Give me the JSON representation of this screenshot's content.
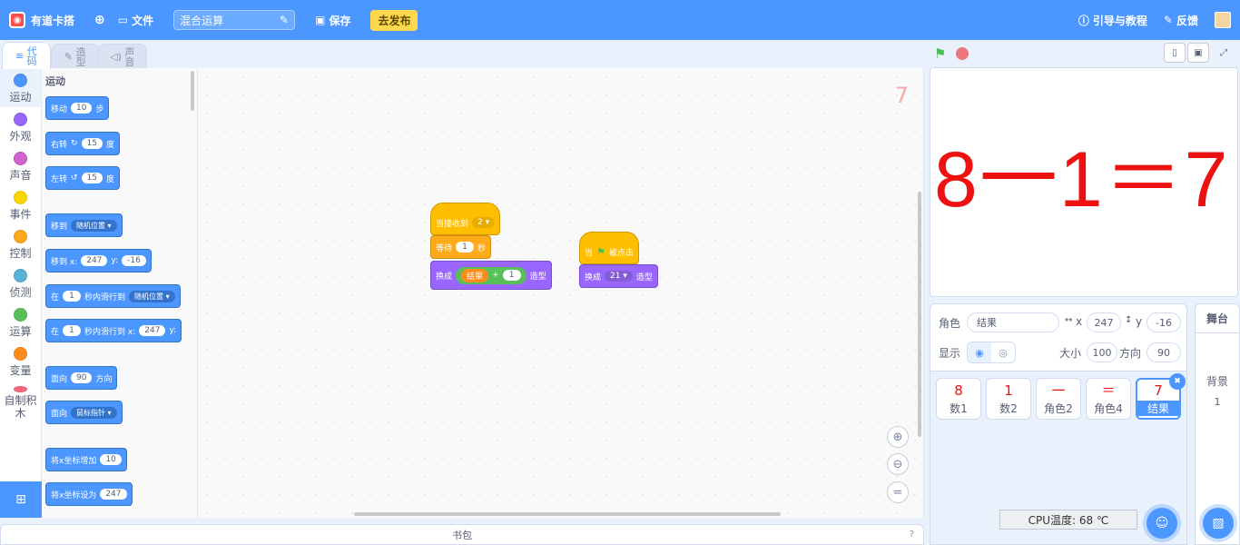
{
  "topbar": {
    "brand": "有道卡搭",
    "file_menu": "文件",
    "project_title": "混合运算",
    "save": "保存",
    "publish": "去发布",
    "guide": "引导与教程",
    "feedback": "反馈"
  },
  "tabs": {
    "code": "代码",
    "costumes": "造型",
    "sounds": "声音"
  },
  "categories": [
    {
      "label": "运动",
      "color": "#4c97ff"
    },
    {
      "label": "外观",
      "color": "#9966ff"
    },
    {
      "label": "声音",
      "color": "#cf63cf"
    },
    {
      "label": "事件",
      "color": "#ffd500"
    },
    {
      "label": "控制",
      "color": "#ffab19"
    },
    {
      "label": "侦测",
      "color": "#5cb1d6"
    },
    {
      "label": "运算",
      "color": "#59c059"
    },
    {
      "label": "变量",
      "color": "#ff8c1a"
    },
    {
      "label": "自制积木",
      "color": "#ff6680"
    }
  ],
  "palette": {
    "section": "运动",
    "move": {
      "a": "移动",
      "n": "10",
      "b": "步"
    },
    "turn_right": {
      "a": "右转",
      "icon": "rotate-cw-icon",
      "n": "15",
      "b": "度"
    },
    "turn_left": {
      "a": "左转",
      "icon": "rotate-ccw-icon",
      "n": "15",
      "b": "度"
    },
    "goto": {
      "a": "移到",
      "dd": "随机位置"
    },
    "goto_xy": {
      "a": "移到 x:",
      "x": "247",
      "b": "y:",
      "y": "-16"
    },
    "glide": {
      "a": "在",
      "n": "1",
      "b": "秒内滑行到",
      "dd": "随机位置"
    },
    "glide_xy": {
      "a": "在",
      "n": "1",
      "b": "秒内滑行到 x:",
      "x": "247",
      "c": "y:"
    },
    "point_dir": {
      "a": "面向",
      "n": "90",
      "b": "方向"
    },
    "point_towards": {
      "a": "面向",
      "dd": "鼠标指针"
    },
    "change_x": {
      "a": "将x坐标增加",
      "n": "10"
    },
    "set_x": {
      "a": "将x坐标设为",
      "n": "247"
    }
  },
  "scripts": {
    "corner_number": "7",
    "script1": {
      "hat": {
        "a": "当接收到",
        "dd": "2"
      },
      "wait": {
        "a": "等待",
        "n": "1",
        "b": "秒"
      },
      "switch": {
        "a": "换成",
        "var": "结果",
        "op": "+",
        "n": "1",
        "b": "造型"
      }
    },
    "script2": {
      "hat": {
        "a": "当",
        "b": "被点击"
      },
      "switch": {
        "a": "换成",
        "dd": "21",
        "b": "造型"
      }
    }
  },
  "backpack": {
    "label": "书包"
  },
  "stage": {
    "display_text": "8一1＝7"
  },
  "sprite_info": {
    "sprite_label": "角色",
    "sprite_name": "结果",
    "x_label": "x",
    "x": "247",
    "y_label": "y",
    "y": "-16",
    "show_label": "显示",
    "size_label": "大小",
    "size": "100",
    "direction_label": "方向",
    "direction": "90"
  },
  "sprites": [
    {
      "glyph": "8",
      "name": "数1",
      "selected": false
    },
    {
      "glyph": "1",
      "name": "数2",
      "selected": false
    },
    {
      "glyph": "一",
      "name": "角色2",
      "selected": false
    },
    {
      "glyph": "＝",
      "name": "角色4",
      "selected": false
    },
    {
      "glyph": "7",
      "name": "结果",
      "selected": true
    }
  ],
  "cpu": "CPU温度: 68 ℃",
  "stage_pane": {
    "header": "舞台",
    "backdrop_label": "背景",
    "backdrop_count": "1"
  }
}
